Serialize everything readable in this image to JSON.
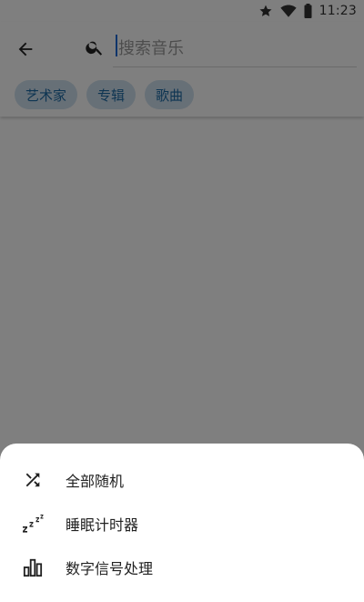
{
  "status_bar": {
    "time": "11:23",
    "icons": [
      "star-icon",
      "wifi-icon",
      "battery-icon"
    ]
  },
  "search": {
    "placeholder": "搜索音乐",
    "value": ""
  },
  "filters": [
    {
      "label": "艺术家"
    },
    {
      "label": "专辑"
    },
    {
      "label": "歌曲"
    }
  ],
  "menu": {
    "items": [
      {
        "label": "全部随机",
        "icon": "shuffle-icon"
      },
      {
        "label": "睡眠计时器",
        "icon": "sleep-timer-icon"
      },
      {
        "label": "数字信号处理",
        "icon": "equalizer-icon"
      }
    ]
  },
  "colors": {
    "chip_bg": "#cfe0ee",
    "chip_text": "#1d6aa5",
    "caret": "#1e6bd6",
    "scrim": "rgba(0,0,0,0.5)"
  }
}
